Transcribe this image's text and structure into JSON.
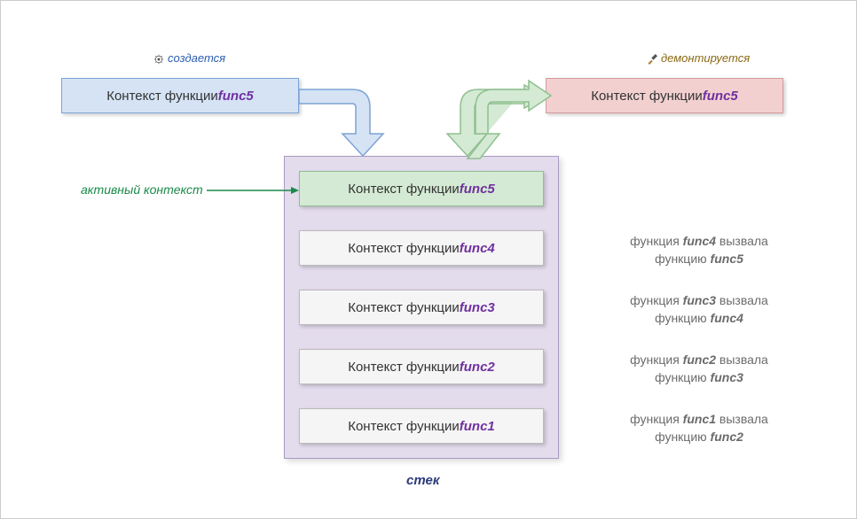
{
  "labels": {
    "created": "создается",
    "dismounted": "демонтируется",
    "active_context": "активный контекст",
    "stack": "стек"
  },
  "top_left_box": {
    "prefix": "Контекст функции ",
    "func": "func5"
  },
  "top_right_box": {
    "prefix": "Контекст функции ",
    "func": "func5"
  },
  "stack": {
    "items": [
      {
        "prefix": "Контекст функции ",
        "func": "func5",
        "active": true
      },
      {
        "prefix": "Контекст функции ",
        "func": "func4",
        "active": false
      },
      {
        "prefix": "Контекст функции ",
        "func": "func3",
        "active": false
      },
      {
        "prefix": "Контекст функции ",
        "func": "func2",
        "active": false
      },
      {
        "prefix": "Контекст функции ",
        "func": "func1",
        "active": false
      }
    ]
  },
  "descriptions": [
    {
      "line1a": "функция  ",
      "line1b": "func4",
      "line1c": "  вызвала",
      "line2a": "функцию ",
      "line2b": "func5"
    },
    {
      "line1a": "функция  ",
      "line1b": "func3",
      "line1c": "  вызвала",
      "line2a": "функцию ",
      "line2b": "func4"
    },
    {
      "line1a": "функция  ",
      "line1b": "func2",
      "line1c": "  вызвала",
      "line2a": "функцию ",
      "line2b": "func3"
    },
    {
      "line1a": "функция  ",
      "line1b": "func1",
      "line1c": "  вызвала",
      "line2a": "функцию ",
      "line2b": "func2"
    }
  ]
}
